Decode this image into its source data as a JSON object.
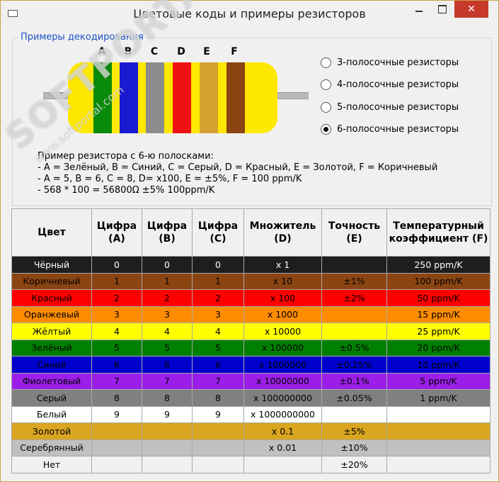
{
  "window": {
    "title": "Цветовые коды и примеры резисторов"
  },
  "group": {
    "title": "Примеры декодирования"
  },
  "resistor": {
    "band_letters": [
      "A",
      "B",
      "C",
      "D",
      "E",
      "F"
    ],
    "body_color": "#ffe800",
    "band_colors": [
      "#0a8a0a",
      "#1a1ad0",
      "#8c8c8c",
      "#ee1111",
      "#d4a030",
      "#8b4513"
    ]
  },
  "options": [
    {
      "label": "3-полосочные резисторы",
      "selected": false
    },
    {
      "label": "4-полосочные резисторы",
      "selected": false
    },
    {
      "label": "5-полосочные резисторы",
      "selected": false
    },
    {
      "label": "6-полосочные резисторы",
      "selected": true
    }
  ],
  "example_lines": [
    "Пример резистора с 6-ю полосками:",
    "- A = Зелёный, B = Синий, C = Серый, D = Красный, E = Золотой, F = Коричневый",
    "- A = 5, B = 6, C = 8, D= x100, E = ±5%, F = 100 ppm/K",
    "- 568 * 100 = 56800Ω ±5% 100ppm/K"
  ],
  "watermark": {
    "text": "SOFTPORTAL",
    "sub": "www.softportal.com"
  },
  "table": {
    "headers": [
      "Цвет",
      "Цифра (A)",
      "Цифра (B)",
      "Цифра (C)",
      "Множитель (D)",
      "Точность (E)",
      "Температурный коэффициент (F)"
    ],
    "rows": [
      {
        "bg": "#1e1e1e",
        "fg": "#ffffff",
        "cells": [
          "Чёрный",
          "0",
          "0",
          "0",
          "x 1",
          "",
          "250 ppm/K"
        ]
      },
      {
        "bg": "#8b4513",
        "fg": "#000000",
        "cells": [
          "Коричневый",
          "1",
          "1",
          "1",
          "x 10",
          "±1%",
          "100 ppm/K"
        ]
      },
      {
        "bg": "#ff0000",
        "fg": "#000000",
        "cells": [
          "Красный",
          "2",
          "2",
          "2",
          "x 100",
          "±2%",
          "50 ppm/K"
        ]
      },
      {
        "bg": "#ff8c00",
        "fg": "#000000",
        "cells": [
          "Оранжевый",
          "3",
          "3",
          "3",
          "x 1000",
          "",
          "15 ppm/K"
        ]
      },
      {
        "bg": "#ffff00",
        "fg": "#000000",
        "cells": [
          "Жёлтый",
          "4",
          "4",
          "4",
          "x 10000",
          "",
          "25 ppm/K"
        ]
      },
      {
        "bg": "#008000",
        "fg": "#000000",
        "cells": [
          "Зелёный",
          "5",
          "5",
          "5",
          "x 100000",
          "±0.5%",
          "20 ppm/K"
        ]
      },
      {
        "bg": "#0000cd",
        "fg": "#000000",
        "cells": [
          "Синий",
          "6",
          "6",
          "6",
          "x 1000000",
          "±0.25%",
          "10 ppm/K"
        ]
      },
      {
        "bg": "#9b1fe8",
        "fg": "#000000",
        "cells": [
          "Фиолетовый",
          "7",
          "7",
          "7",
          "x 10000000",
          "±0.1%",
          "5 ppm/K"
        ]
      },
      {
        "bg": "#808080",
        "fg": "#000000",
        "cells": [
          "Серый",
          "8",
          "8",
          "8",
          "x 100000000",
          "±0.05%",
          "1 ppm/K"
        ]
      },
      {
        "bg": "#ffffff",
        "fg": "#000000",
        "cells": [
          "Белый",
          "9",
          "9",
          "9",
          "x 1000000000",
          "",
          ""
        ]
      },
      {
        "bg": "#daa520",
        "fg": "#000000",
        "cells": [
          "Золотой",
          "",
          "",
          "",
          "x 0.1",
          "±5%",
          ""
        ]
      },
      {
        "bg": "#c0c0c0",
        "fg": "#000000",
        "cells": [
          "Серебрянный",
          "",
          "",
          "",
          "x 0.01",
          "±10%",
          ""
        ]
      },
      {
        "bg": "#f0f0f0",
        "fg": "#000000",
        "cells": [
          "Нет",
          "",
          "",
          "",
          "",
          "±20%",
          ""
        ]
      }
    ]
  }
}
